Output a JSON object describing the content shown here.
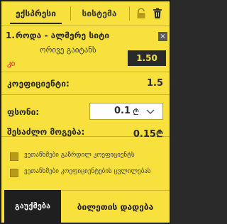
{
  "tabs": {
    "express": "ექსპრესი",
    "system": "სისტემა"
  },
  "icons": {
    "lock": "lock-icon",
    "trash": "trash-icon",
    "close": "close-icon",
    "chevron": "chevron-down-icon",
    "currency": "lari-icon"
  },
  "bet": {
    "number": "1.",
    "title": "როდა - ალმერე სიტი",
    "market": "ორივე გაიტანს",
    "pick": "კი",
    "odds": "1.50",
    "remove": "×"
  },
  "summary": {
    "coef_label": "კოეფიციენტი:",
    "coef_value": "1.5",
    "stake_label": "ფსონი:",
    "stake_value": "0.1",
    "currency_symbol": "₾",
    "win_label": "შესაძლო მოგება:",
    "win_value": "0.15₾"
  },
  "options": {
    "accept_higher": "ვეთანხმები გაზრდილ კოეფიციენტს",
    "accept_changes": "ვეთანხმები კოეფიციენტების ცვლილებას"
  },
  "footer": {
    "clear": "გაუქმება",
    "place": "ბილეთის დადება"
  },
  "colors": {
    "background": "#f8e13c",
    "dark": "#2a2a2a",
    "pick_red": "#d42020",
    "odds_text": "#f3e24a"
  }
}
